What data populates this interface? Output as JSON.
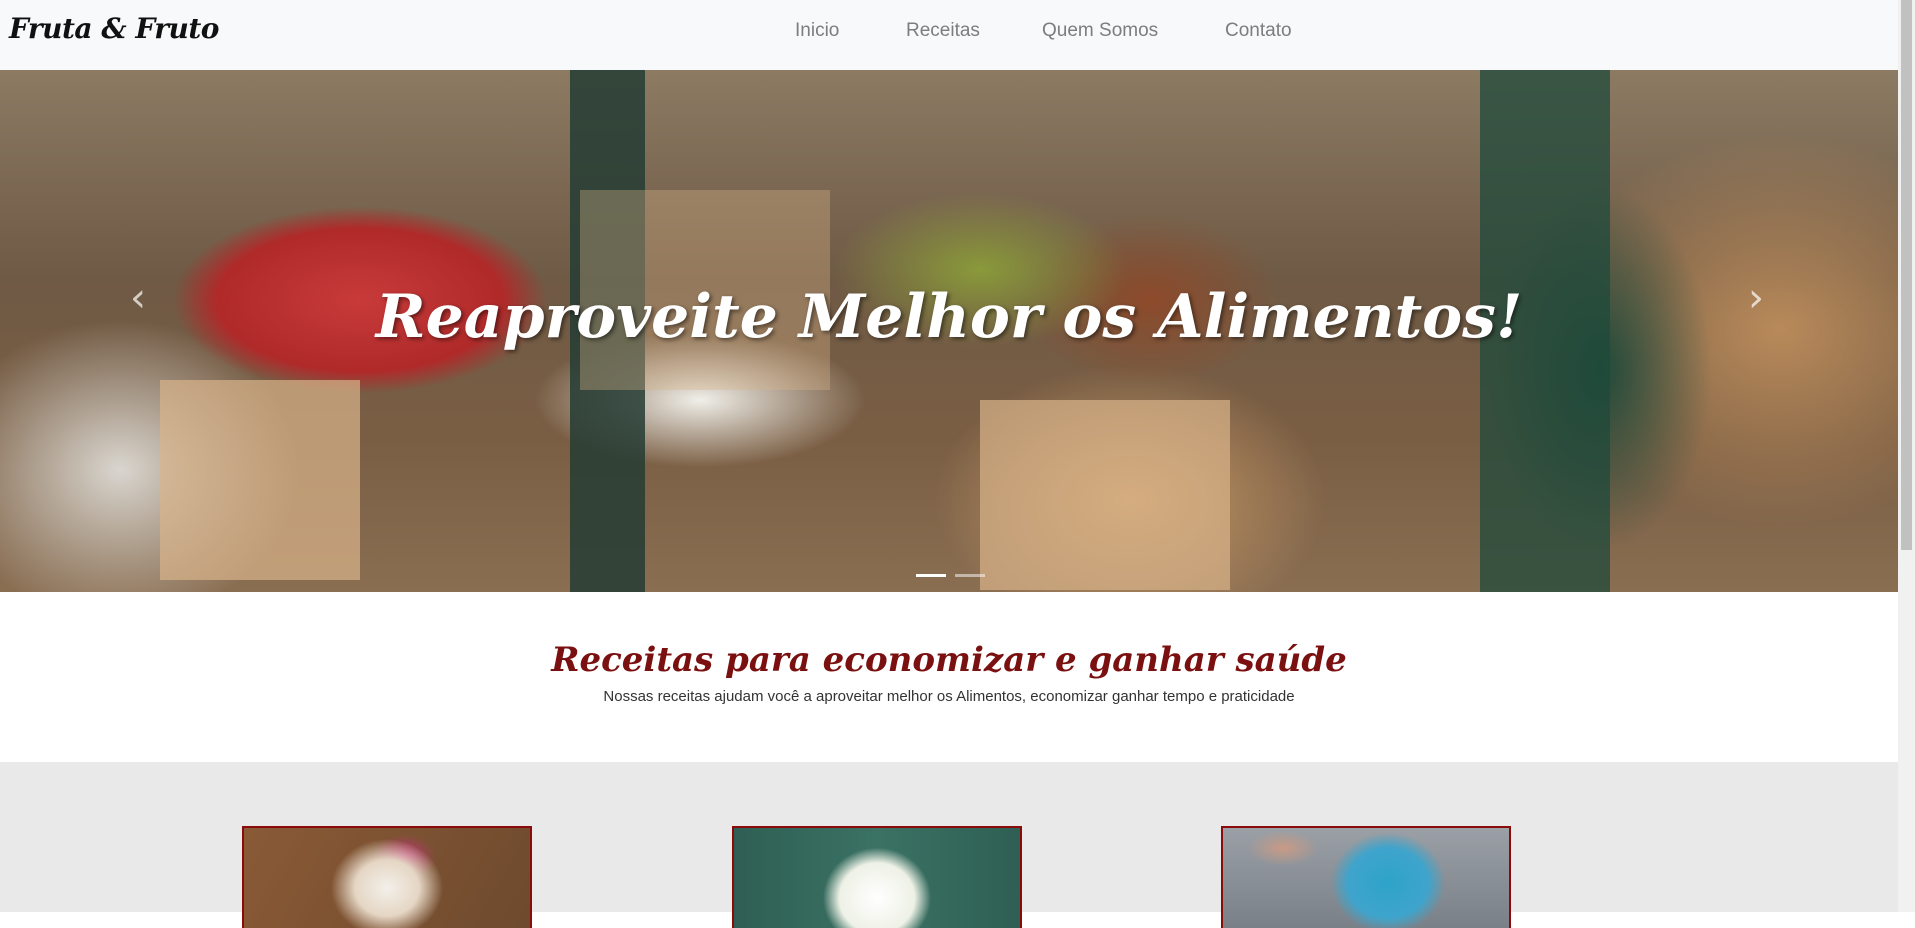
{
  "navbar": {
    "brand": "Fruta & Fruto",
    "links": [
      "Inicio",
      "Receitas",
      "Quem Somos",
      "Contato"
    ]
  },
  "hero": {
    "title": "Reaproveite Melhor os Alimentos!",
    "prev_icon": "chevron-left-icon",
    "next_icon": "chevron-right-icon",
    "slides": 2,
    "active_slide": 1
  },
  "section": {
    "title": "Receitas para economizar e ganhar saúde",
    "subtitle": "Nossas receitas ajudam você a aproveitar melhor os Alimentos, economizar ganhar tempo e praticidade"
  },
  "cards": [
    {
      "name": "recipe-card-1"
    },
    {
      "name": "recipe-card-2"
    },
    {
      "name": "recipe-card-3"
    }
  ],
  "colors": {
    "accent": "#8b0a0a",
    "navbar_bg": "#f8f9fa",
    "band_bg": "#e9e9e9"
  }
}
